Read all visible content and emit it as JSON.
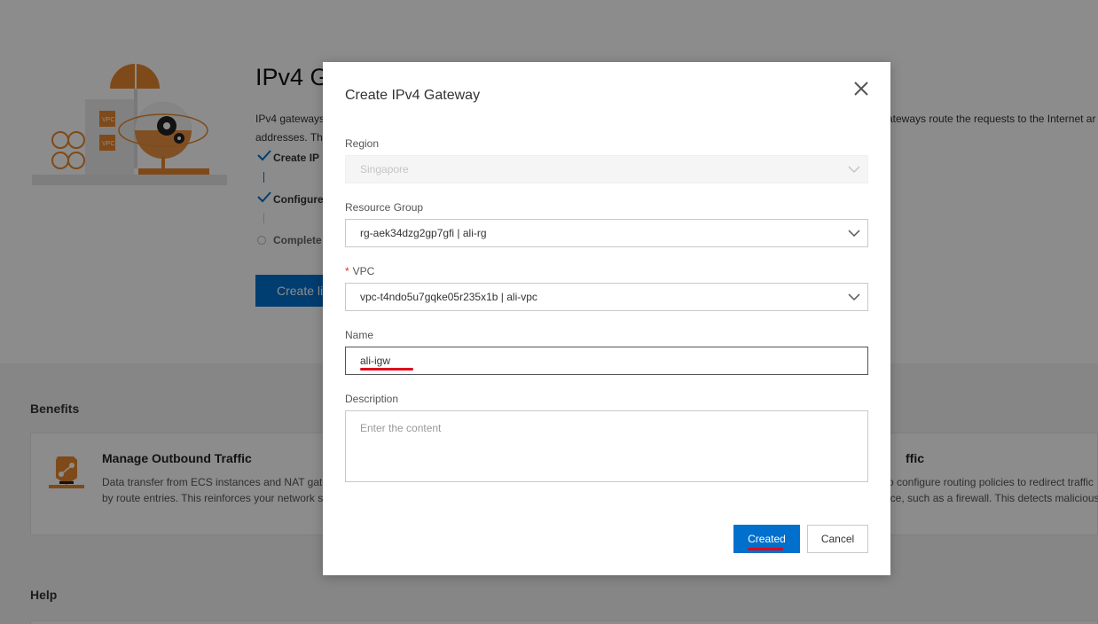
{
  "background": {
    "hero_title": "IPv4 G",
    "hero_desc_left_1": "IPv4 gateways",
    "hero_desc_left_2": "addresses. This",
    "hero_desc_right": "ateways route the requests to the Internet ar",
    "steps": [
      {
        "label": "Create IP",
        "state": "done"
      },
      {
        "label": "Configure",
        "state": "done"
      },
      {
        "label": "Complete",
        "state": "pending"
      }
    ],
    "create_button": "Create li",
    "benefits_title": "Benefits",
    "benefit_left": {
      "title": "Manage Outbound Traffic",
      "line1": "Data transfer from ECS instances and NAT gate",
      "line2": "by route entries. This reinforces your network s"
    },
    "benefit_right": {
      "title": "ffic",
      "line1": "o configure routing policies to redirect traffic",
      "line2": "ice, such as a firewall. This detects malicious"
    },
    "help_title": "Help"
  },
  "dialog": {
    "title": "Create IPv4 Gateway",
    "region": {
      "label": "Region",
      "value": "Singapore"
    },
    "resource_group": {
      "label": "Resource Group",
      "value": "rg-aek34dzg2gp7gfi | ali-rg"
    },
    "vpc": {
      "required_mark": "*",
      "label": "VPC",
      "value": "vpc-t4ndo5u7gqke05r235x1b | ali-vpc"
    },
    "name": {
      "label": "Name",
      "value": "ali-igw"
    },
    "description": {
      "label": "Description",
      "placeholder": "Enter the content"
    },
    "primary_button": "Created",
    "cancel_button": "Cancel"
  },
  "colors": {
    "primary": "#0070cc",
    "annotation": "#e0001b",
    "illustration_orange": "#e8872f"
  }
}
